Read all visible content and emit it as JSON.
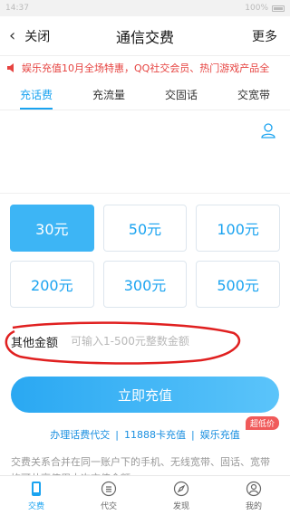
{
  "status_bar": {
    "time": "14:37",
    "battery": "100%"
  },
  "nav": {
    "back_label": "关闭",
    "title": "通信交费",
    "more_label": "更多"
  },
  "notice": {
    "text": "娱乐充值10月全场特惠，QQ社交会员、热门游戏产品全"
  },
  "tabs": [
    {
      "label": "充话费",
      "active": true
    },
    {
      "label": "充流量"
    },
    {
      "label": "交固话"
    },
    {
      "label": "交宽带"
    }
  ],
  "amounts": [
    {
      "label": "30元",
      "active": true
    },
    {
      "label": "50元"
    },
    {
      "label": "100元"
    },
    {
      "label": "200元"
    },
    {
      "label": "300元"
    },
    {
      "label": "500元"
    }
  ],
  "other": {
    "label": "其他金额",
    "placeholder": "可输入1-500元整数金额"
  },
  "recharge_button": "立即充值",
  "links": {
    "agent": "办理话费代交",
    "card": "11888卡充值",
    "entertainment": "娱乐充值",
    "badge": "超低价"
  },
  "description": "交费关系合并在同一账户下的手机、无线宽带、固话、宽带均可共享使用本次充值金额。",
  "bottom_nav": [
    {
      "label": "交费",
      "icon": "phone-icon",
      "active": true
    },
    {
      "label": "代交",
      "icon": "list-icon"
    },
    {
      "label": "发现",
      "icon": "compass-icon"
    },
    {
      "label": "我的",
      "icon": "user-icon"
    }
  ],
  "colors": {
    "accent": "#1aa3f0",
    "notice": "#e64340",
    "annotation": "#e02020"
  }
}
